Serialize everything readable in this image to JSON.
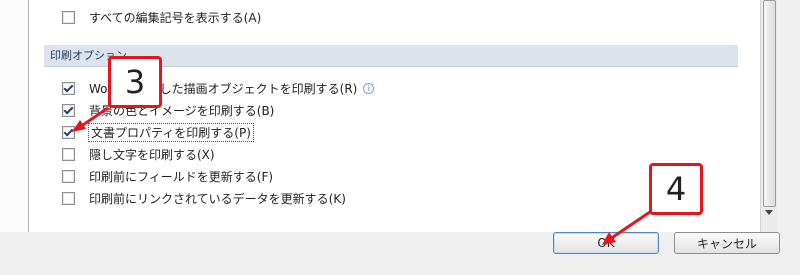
{
  "options": {
    "show_all_marks": "すべての編集記号を表示する(A)",
    "section_title": "印刷オプション",
    "items": [
      {
        "label": "Word で作成した描画オブジェクトを印刷する(R)",
        "checked": true
      },
      {
        "label": "背景の色とイメージを印刷する(B)",
        "checked": true
      },
      {
        "label": "文書プロパティを印刷する(P)",
        "checked": true
      },
      {
        "label": "隠し文字を印刷する(X)",
        "checked": false
      },
      {
        "label": "印刷前にフィールドを更新する(F)",
        "checked": false
      },
      {
        "label": "印刷前にリンクされているデータを更新する(K)",
        "checked": false
      }
    ],
    "info_icon": "i"
  },
  "buttons": {
    "ok": "OK",
    "cancel": "キャンセル"
  },
  "callouts": {
    "step3": "3",
    "step4": "4"
  },
  "colors": {
    "callout_red": "#e3161e",
    "section_bg": "#dde3ec"
  }
}
